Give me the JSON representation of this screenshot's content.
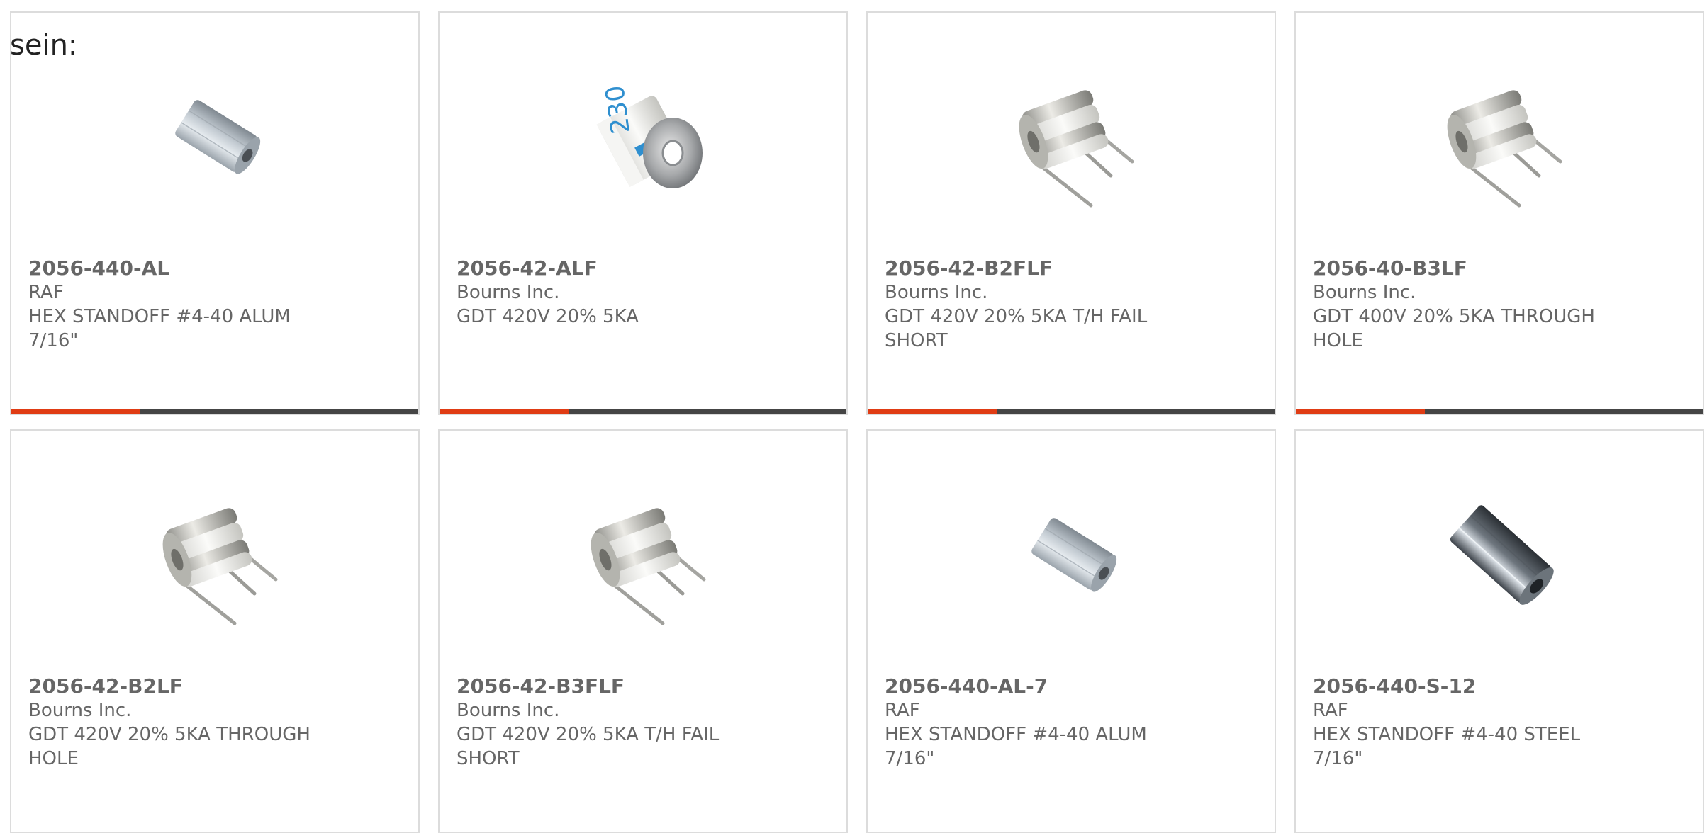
{
  "intro_text": "sein:",
  "colors": {
    "accent": "#e03c14",
    "bar": "#454545",
    "text": "#666666",
    "border": "#dcdcdc"
  },
  "products": [
    {
      "part_number": "2056-440-AL",
      "manufacturer": "RAF",
      "description": "HEX STANDOFF #4-40 ALUM 7/16\"",
      "image": "hex-standoff-aluminum-image"
    },
    {
      "part_number": "2056-42-ALF",
      "manufacturer": "Bourns Inc.",
      "description": "GDT 420V 20% 5KA",
      "image": "gdt-cylinder-image"
    },
    {
      "part_number": "2056-42-B2FLF",
      "manufacturer": "Bourns Inc.",
      "description": "GDT 420V 20% 5KA T/H FAIL SHORT",
      "image": "gdt-three-lead-image"
    },
    {
      "part_number": "2056-40-B3LF",
      "manufacturer": "Bourns Inc.",
      "description": "GDT 400V 20% 5KA THROUGH HOLE",
      "image": "gdt-three-lead-image"
    },
    {
      "part_number": "2056-42-B2LF",
      "manufacturer": "Bourns Inc.",
      "description": "GDT 420V 20% 5KA THROUGH HOLE",
      "image": "gdt-three-lead-image"
    },
    {
      "part_number": "2056-42-B3FLF",
      "manufacturer": "Bourns Inc.",
      "description": "GDT 420V 20% 5KA T/H FAIL SHORT",
      "image": "gdt-three-lead-image"
    },
    {
      "part_number": "2056-440-AL-7",
      "manufacturer": "RAF",
      "description": "HEX STANDOFF #4-40 ALUM 7/16\"",
      "image": "hex-standoff-aluminum-image"
    },
    {
      "part_number": "2056-440-S-12",
      "manufacturer": "RAF",
      "description": "HEX STANDOFF #4-40 STEEL 7/16\"",
      "image": "hex-standoff-steel-image"
    }
  ],
  "gdt_label": "230"
}
